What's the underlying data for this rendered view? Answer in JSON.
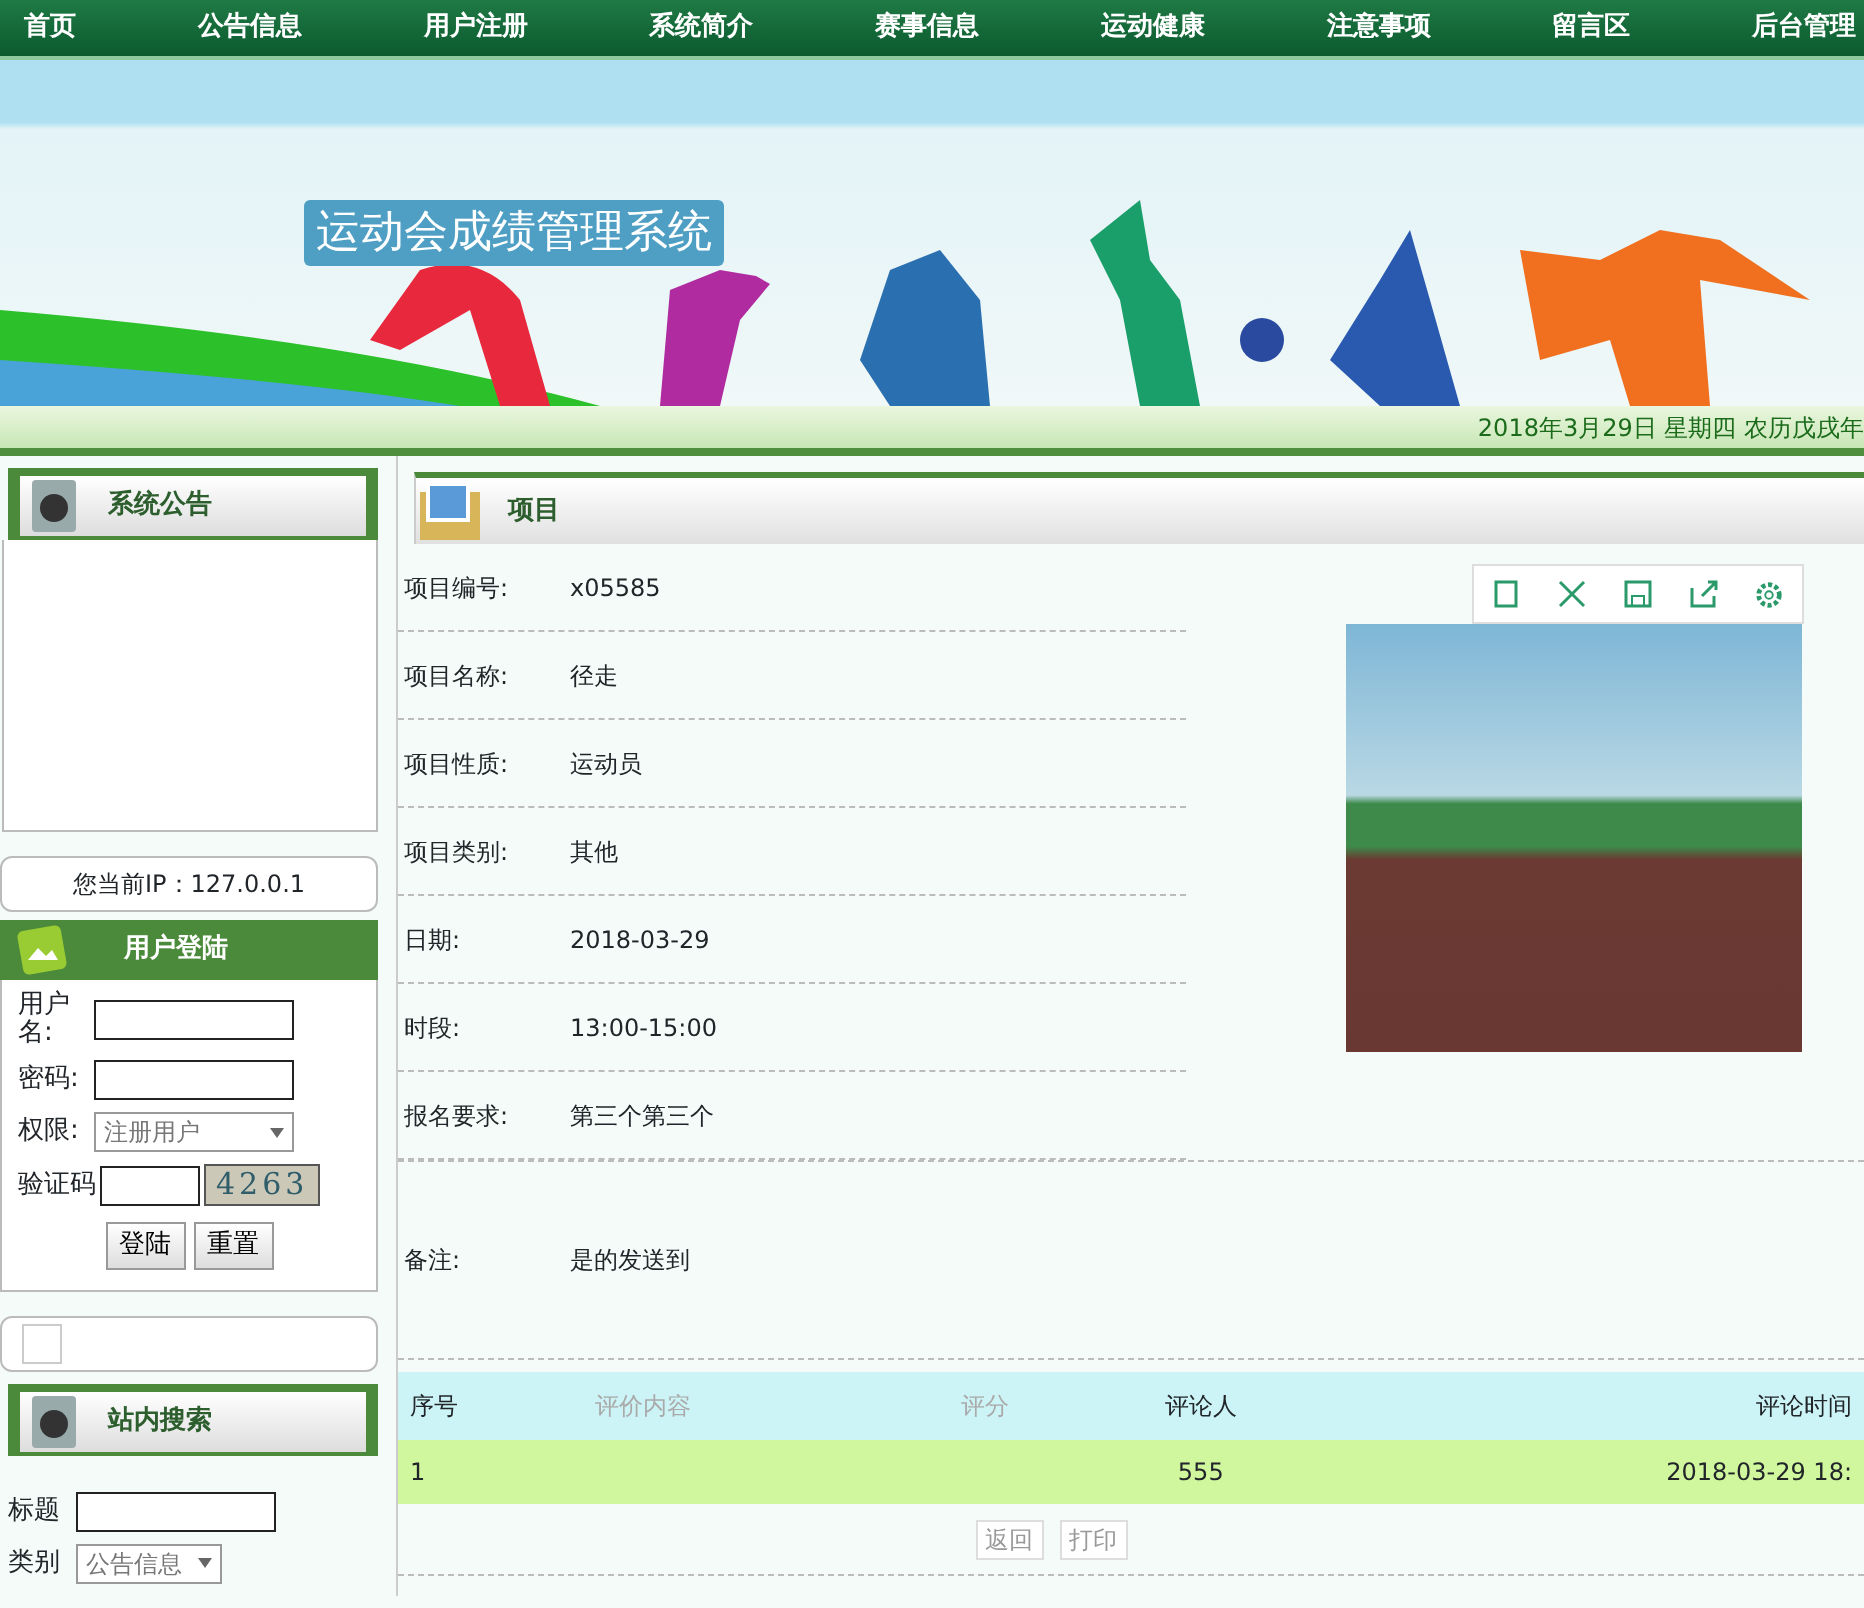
{
  "nav": [
    {
      "label": "首页"
    },
    {
      "label": "公告信息"
    },
    {
      "label": "用户注册"
    },
    {
      "label": "系统简介"
    },
    {
      "label": "赛事信息"
    },
    {
      "label": "运动健康"
    },
    {
      "label": "注意事项"
    },
    {
      "label": "留言区"
    },
    {
      "label": "后台管理"
    }
  ],
  "banner": {
    "title": "运动会成绩管理系统"
  },
  "date_bar": "2018年3月29日  星期四  农历戊戌年",
  "sidebar": {
    "notice": {
      "title": "系统公告"
    },
    "ip": "您当前IP：127.0.0.1",
    "login": {
      "title": "用户登陆",
      "username_label": "用户名:",
      "password_label": "密码:",
      "role_label": "权限:",
      "role_value": "注册用户",
      "captcha_label": "验证码",
      "captcha": "4263",
      "buttons": [
        "登陆",
        "重置"
      ]
    },
    "search": {
      "title": "站内搜索",
      "title_label": "标题",
      "category_label": "类别",
      "category_value": "公告信息"
    }
  },
  "main": {
    "title": "项目",
    "fields": [
      {
        "label": "项目编号:",
        "value": "x05585"
      },
      {
        "label": "项目名称:",
        "value": "径走"
      },
      {
        "label": "项目性质:",
        "value": "运动员"
      },
      {
        "label": "项目类别:",
        "value": "其他"
      },
      {
        "label": "日期:",
        "value": "2018-03-29"
      },
      {
        "label": "时段:",
        "value": "13:00-15:00"
      },
      {
        "label": "报名要求:",
        "value": "第三个第三个"
      }
    ],
    "remark": {
      "label": "备注:",
      "value": "是的发送到"
    },
    "comments": {
      "columns": [
        "序号",
        "评价内容",
        "评分",
        "评论人",
        "评论时间"
      ],
      "rows": [
        [
          "1",
          "",
          "",
          "555",
          "2018-03-29 18:"
        ]
      ]
    },
    "buttons": [
      "返回",
      "打印"
    ]
  }
}
